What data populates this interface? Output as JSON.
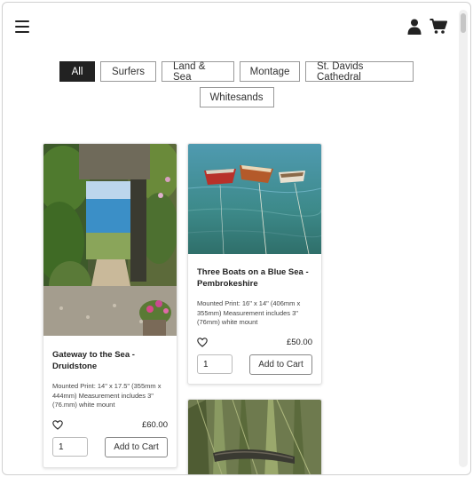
{
  "filters": {
    "row1": [
      "All",
      "Surfers",
      "Land & Sea",
      "Montage",
      "St. Davids Cathedral"
    ],
    "row2": [
      "Whitesands"
    ],
    "active": "All"
  },
  "products": [
    {
      "title": "Gateway to the Sea - Druidstone",
      "description": "Mounted Print: 14\" x 17.5\" (355mm x 444mm) Measurement includes 3\" (76.mm) white mount",
      "price": "£60.00",
      "quantity": "1",
      "add_label": "Add to Cart"
    },
    {
      "title": "Three Boats on a Blue Sea - Pembrokeshire",
      "description": "Mounted Print: 16\" x 14\" (406mm x 355mm) Measurement includes 3\" (76mm) white mount",
      "price": "£50.00",
      "quantity": "1",
      "add_label": "Add to Cart"
    }
  ],
  "colors": {
    "accent": "#222222",
    "border": "#999999"
  }
}
